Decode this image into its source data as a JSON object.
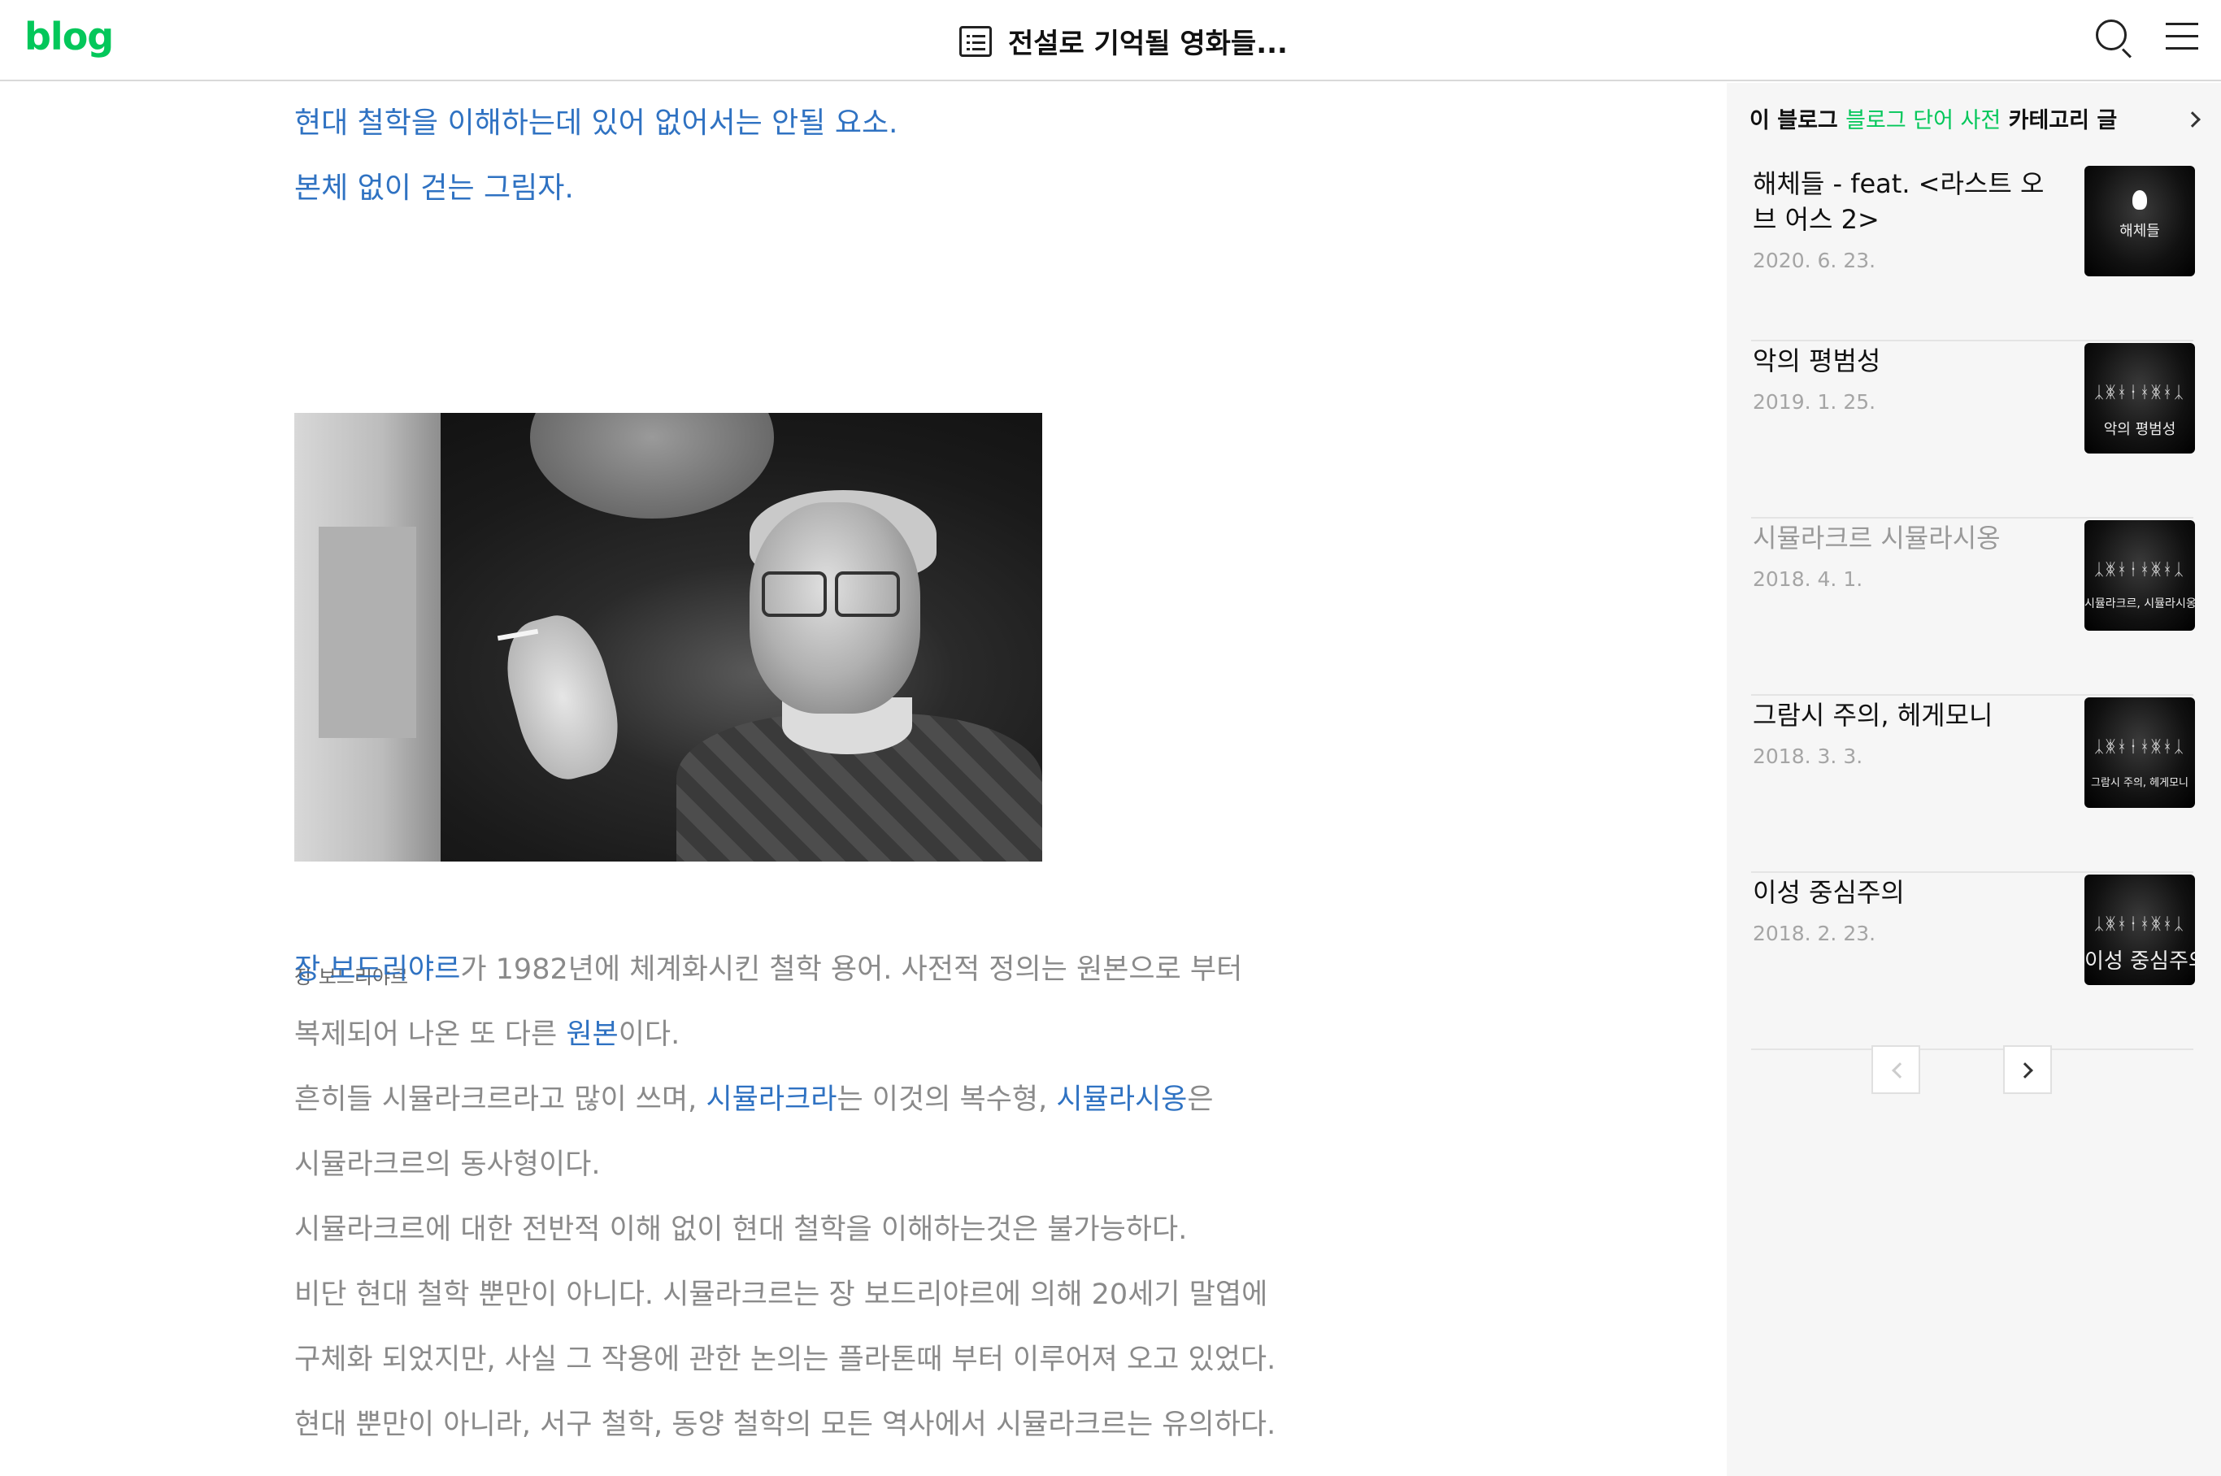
{
  "header": {
    "logo": "blog",
    "title": "전설로 기억될 영화들..."
  },
  "article": {
    "lead_lines": [
      "현대 철학을 이해하는데 있어 없어서는 안될 요소.",
      "본체 없이 걷는 그림자."
    ],
    "image_caption": "장 보드리야르",
    "paragraph": {
      "line1": {
        "link1": "장 보드리야르",
        "text1": "가 1982년에 체계화시킨 철학 용어. 사전적 정의는 원본으로 부터"
      },
      "line2": {
        "text1": "복제되어 나온 또 다른 ",
        "link1": "원본",
        "text2": "이다."
      },
      "line3": {
        "text1": "흔히들 시뮬라크르라고 많이 쓰며, ",
        "link1": "시뮬라크라",
        "text2": "는 이것의 복수형, ",
        "link2": "시뮬라시옹",
        "text3": "은"
      },
      "line4": "시뮬라크르의 동사형이다.",
      "line5": "시뮬라크르에 대한 전반적 이해 없이 현대 철학을 이해하는것은 불가능하다.",
      "line6": "비단 현대 철학 뿐만이 아니다. 시뮬라크르는 장 보드리야르에 의해 20세기 말엽에",
      "line7": "구체화 되었지만, 사실 그 작용에 관한 논의는 플라톤때 부터 이루어져 오고 있었다.",
      "line8": "현대 뿐만이 아니라, 서구 철학, 동양 철학의 모든 역사에서 시뮬라크르는 유의하다."
    }
  },
  "sidebar": {
    "heading_prefix": "이 블로그 ",
    "heading_category": "블로그 단어 사전",
    "heading_suffix": " 카테고리 글",
    "posts": [
      {
        "title": "해체들 - feat. <라스트 오브 어스 2>",
        "date": "2020. 6. 23.",
        "thumb_label": "해체들"
      },
      {
        "title": "악의 평범성",
        "date": "2019. 1. 25.",
        "thumb_label": "악의 평범성"
      },
      {
        "title": "시뮬라크르 시뮬라시옹",
        "date": "2018. 4. 1.",
        "thumb_label": "시뮬라크르, 시뮬라시옹"
      },
      {
        "title": "그람시 주의, 헤게모니",
        "date": "2018. 3. 3.",
        "thumb_label": "그람시 주의, 헤게모니"
      },
      {
        "title": "이성 중심주의",
        "date": "2018. 2. 23.",
        "thumb_label": "이성 중심주의"
      }
    ],
    "thumb_figures": "ᛣᛤᚼᚽᚼᛤᚼᛣ"
  },
  "colors": {
    "brand": "#03c75a",
    "link": "#2f72c2",
    "body_text": "#8a8a8a"
  }
}
